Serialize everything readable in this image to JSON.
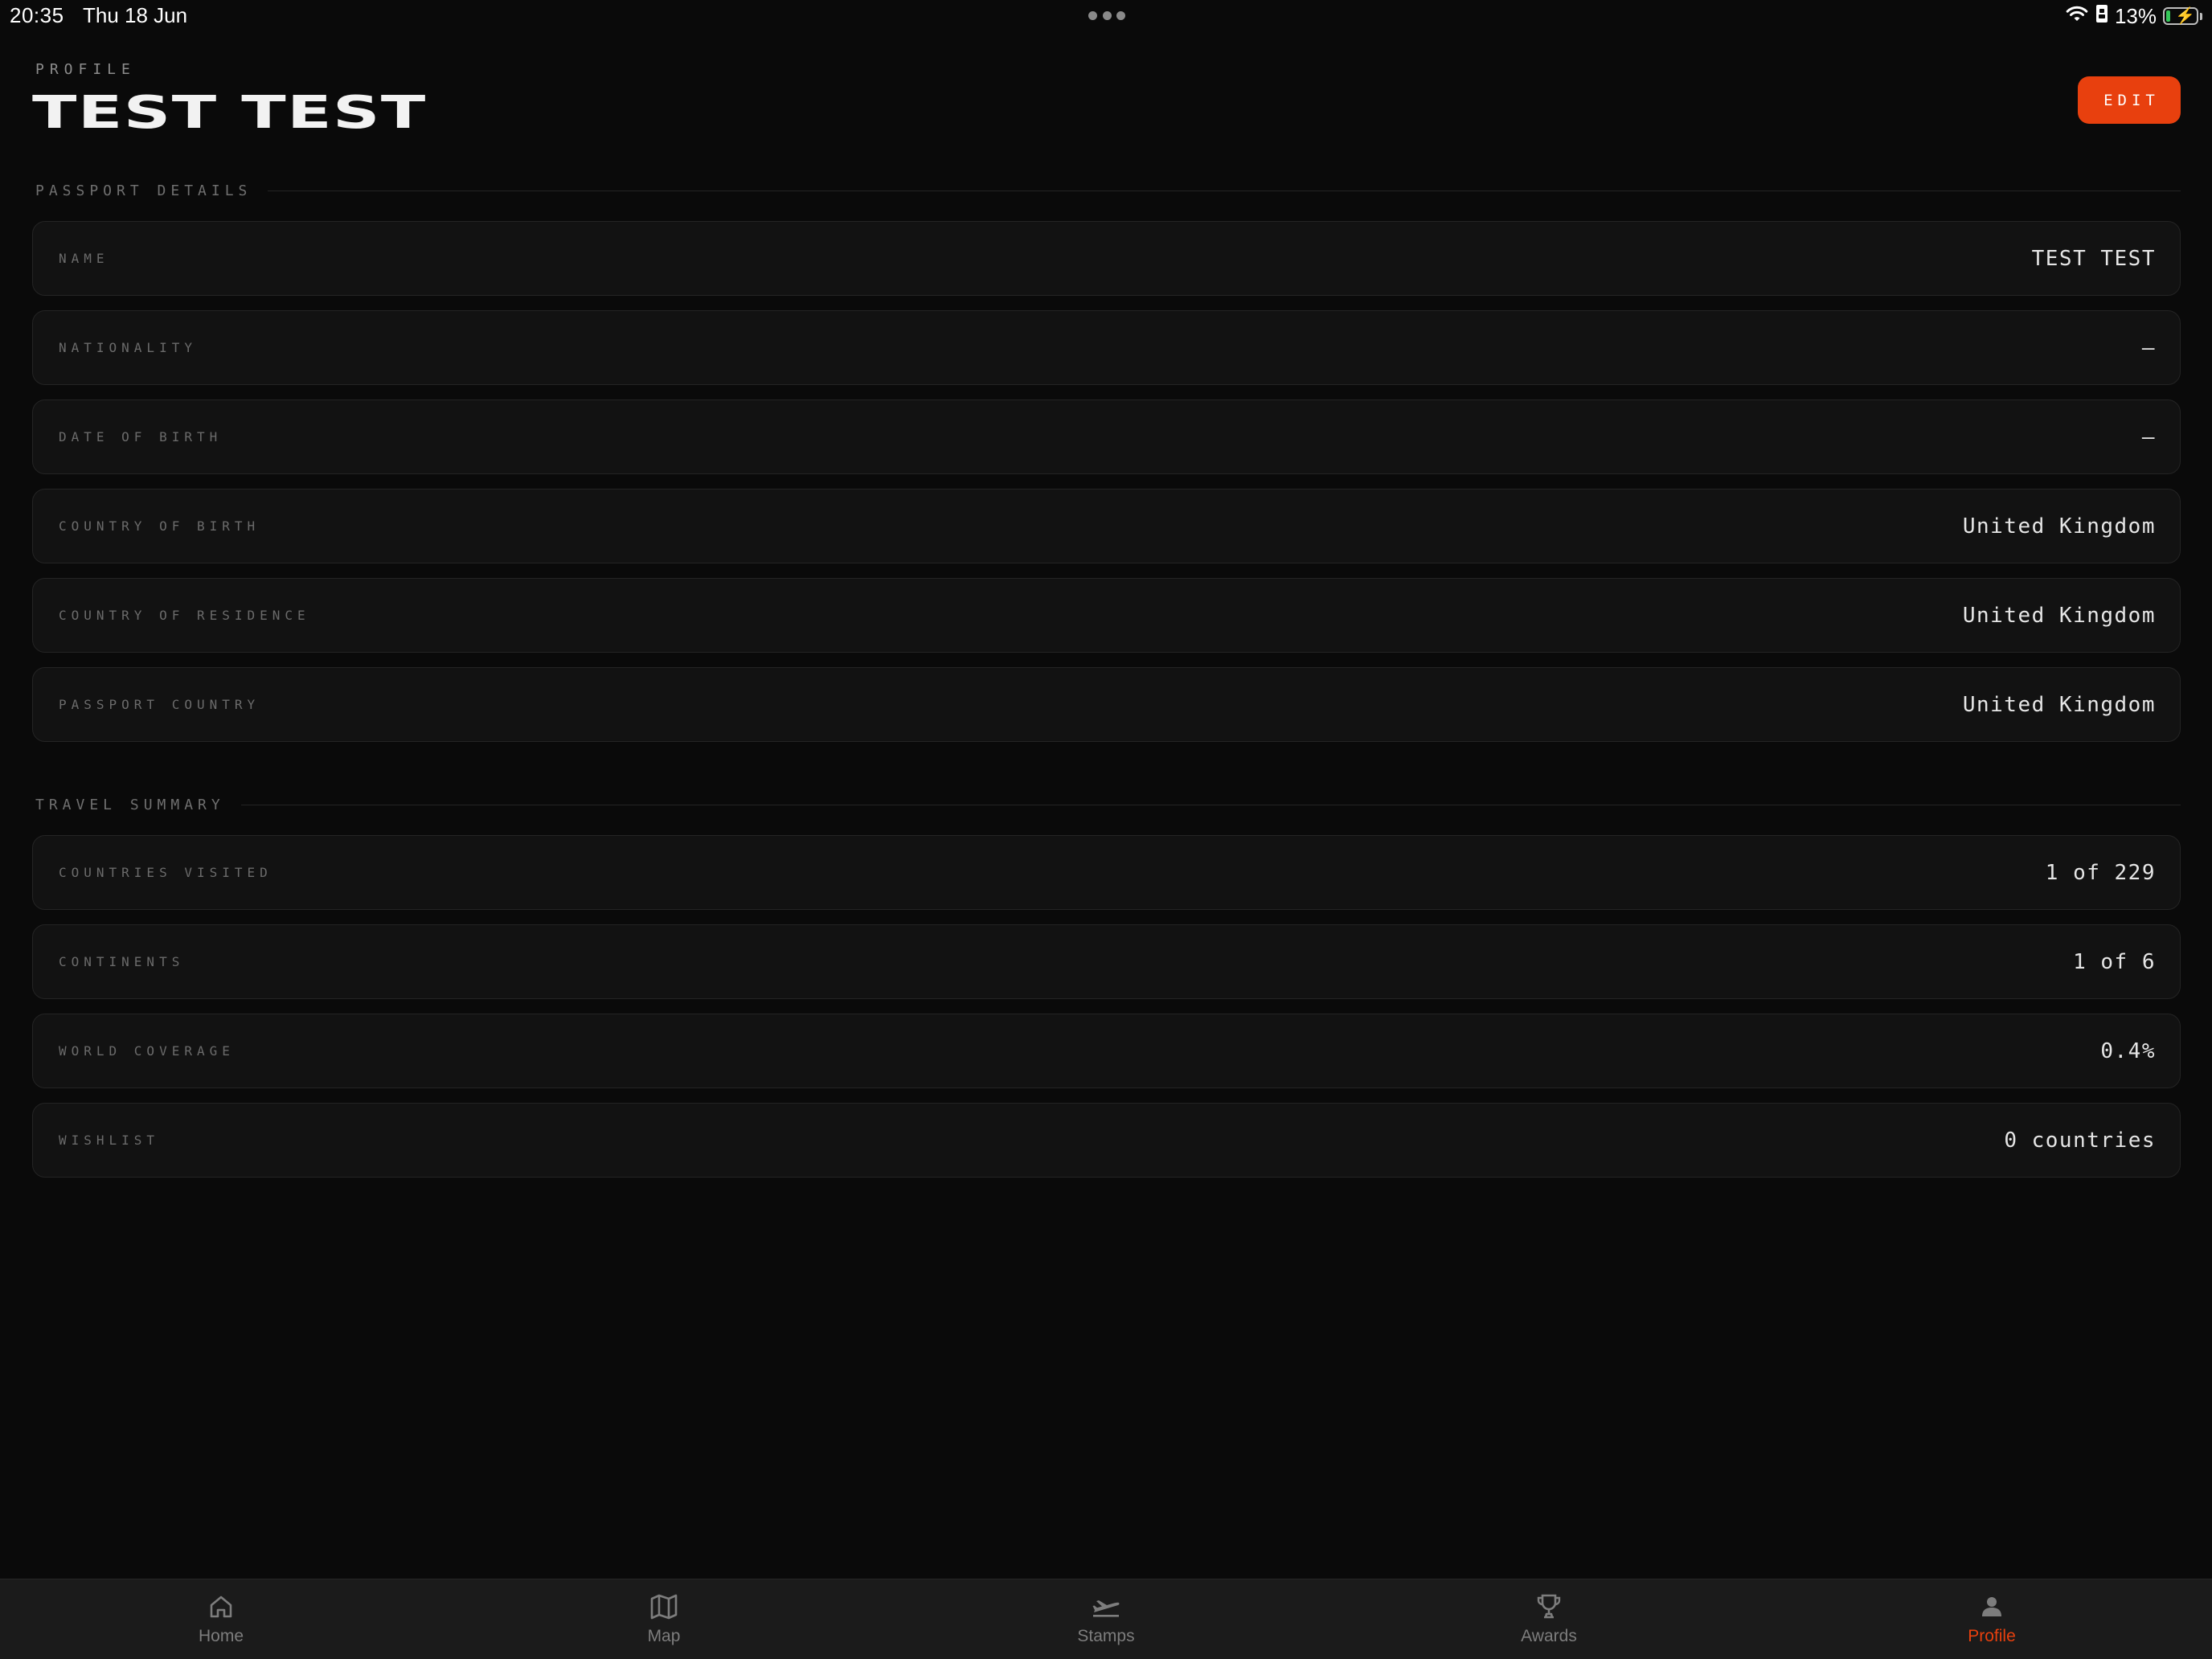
{
  "status_bar": {
    "time": "20:35",
    "date": "Thu 18 Jun",
    "battery_percent": "13%",
    "battery_level": 0.13,
    "battery_charging": true,
    "icons": [
      "wifi-icon",
      "sim-icon",
      "battery-icon"
    ]
  },
  "header": {
    "eyebrow": "PROFILE",
    "title": "TEST TEST",
    "edit_label": "EDIT"
  },
  "passport": {
    "heading": "PASSPORT DETAILS",
    "rows": [
      {
        "label": "NAME",
        "value": "TEST TEST"
      },
      {
        "label": "NATIONALITY",
        "value": "—"
      },
      {
        "label": "DATE OF BIRTH",
        "value": "—"
      },
      {
        "label": "COUNTRY OF BIRTH",
        "value": "United Kingdom"
      },
      {
        "label": "COUNTRY OF RESIDENCE",
        "value": "United Kingdom"
      },
      {
        "label": "PASSPORT COUNTRY",
        "value": "United Kingdom"
      }
    ]
  },
  "travel": {
    "heading": "TRAVEL SUMMARY",
    "rows": [
      {
        "label": "COUNTRIES VISITED",
        "value": "1 of 229"
      },
      {
        "label": "CONTINENTS",
        "value": "1 of 6"
      },
      {
        "label": "WORLD COVERAGE",
        "value": "0.4%"
      },
      {
        "label": "WISHLIST",
        "value": "0 countries"
      }
    ]
  },
  "tabs": [
    {
      "label": "Home",
      "icon": "home-icon",
      "active": false
    },
    {
      "label": "Map",
      "icon": "map-icon",
      "active": false
    },
    {
      "label": "Stamps",
      "icon": "plane-icon",
      "active": false
    },
    {
      "label": "Awards",
      "icon": "trophy-icon",
      "active": false
    },
    {
      "label": "Profile",
      "icon": "person-icon",
      "active": true
    }
  ],
  "colors": {
    "background": "#0a0a0a",
    "card": "#121212",
    "accent": "#e8400e",
    "tab_bar": "#1b1b1b"
  }
}
